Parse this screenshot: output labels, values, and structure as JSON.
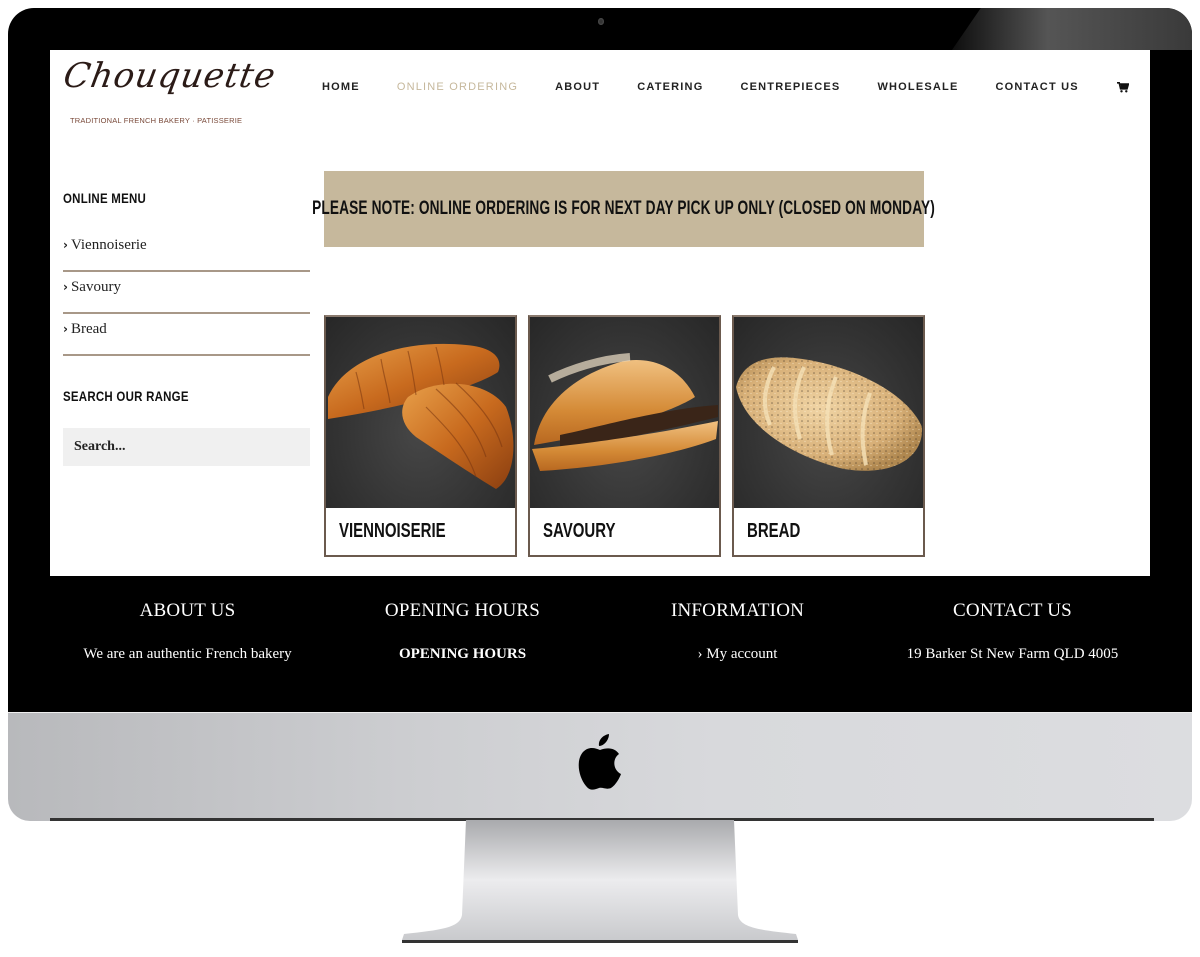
{
  "brand": {
    "name": "Chouquette",
    "tagline": "TRADITIONAL FRENCH BAKERY · PATISSERIE"
  },
  "nav": {
    "items": [
      {
        "label": "HOME",
        "active": false
      },
      {
        "label": "ONLINE ORDERING",
        "active": true
      },
      {
        "label": "ABOUT",
        "active": false
      },
      {
        "label": "CATERING",
        "active": false
      },
      {
        "label": "CENTREPIECES",
        "active": false
      },
      {
        "label": "WHOLESALE",
        "active": false
      },
      {
        "label": "CONTACT US",
        "active": false
      }
    ],
    "icons": [
      "cart-icon",
      "search-icon"
    ]
  },
  "sidebar": {
    "menu_heading": "ONLINE MENU",
    "menu_items": [
      {
        "label": "Viennoiserie"
      },
      {
        "label": "Savoury"
      },
      {
        "label": "Bread"
      }
    ],
    "search_heading": "SEARCH OUR RANGE",
    "search_placeholder": "Search...",
    "search_value": ""
  },
  "notice": {
    "text": "PLEASE NOTE:  ONLINE ORDERING IS FOR NEXT DAY PICK UP ONLY (CLOSED ON MONDAY)"
  },
  "categories": [
    {
      "label": "VIENNOISERIE",
      "image": "croissants"
    },
    {
      "label": "SAVOURY",
      "image": "savoury-croissant"
    },
    {
      "label": "BREAD",
      "image": "seeded-loaf"
    }
  ],
  "footer": {
    "columns": [
      {
        "title": "ABOUT US",
        "body": "We are an authentic French bakery"
      },
      {
        "title": "OPENING HOURS",
        "body": "OPENING HOURS"
      },
      {
        "title": "INFORMATION",
        "body": "› My account"
      },
      {
        "title": "CONTACT US",
        "body": "19 Barker St New Farm QLD 4005"
      }
    ]
  },
  "colors": {
    "accent": "#c6b89c",
    "divider": "#a89888",
    "footer_bg": "#000000"
  }
}
